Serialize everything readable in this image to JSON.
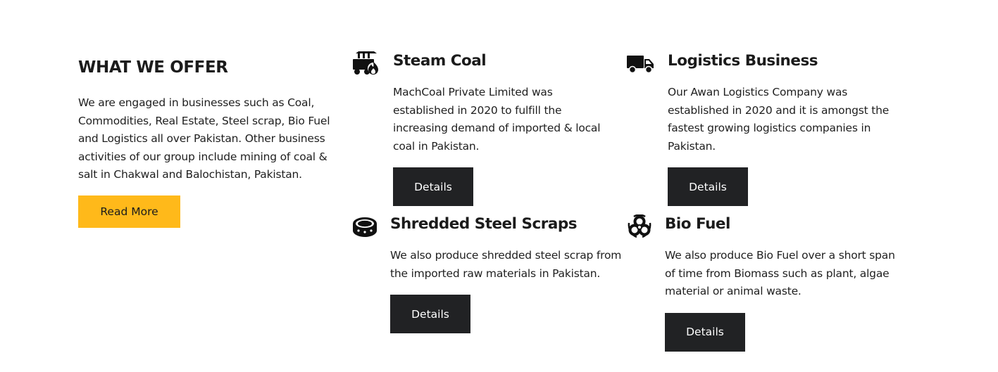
{
  "intro": {
    "title": "WHAT WE OFFER",
    "text": "We are engaged in businesses such as Coal, Commodities, Real Estate, Steel scrap, Bio Fuel and Logistics all over Pakistan. Other business activities of our group include mining of coal & salt in Chakwal and Balochistan, Pakistan.",
    "button_label": "Read More"
  },
  "services": [
    {
      "title": "Steam Coal",
      "icon": "coal-cart-icon",
      "text": "MachCoal Private Limited was established in 2020 to fulfill the increasing demand of imported & local coal in Pakistan.",
      "button_label": "Details"
    },
    {
      "title": "Logistics Business",
      "icon": "truck-icon",
      "text": "Our Awan Logistics Company was established in 2020 and it is amongst the fastest growing logistics companies in Pakistan.",
      "button_label": "Details"
    },
    {
      "title": "Shredded Steel Scraps",
      "icon": "steel-coil-icon",
      "text": "We also produce shredded steel scrap from the imported raw materials in Pakistan.",
      "button_label": "Details"
    },
    {
      "title": "Bio Fuel",
      "icon": "biohazard-icon",
      "text": "We also produce Bio Fuel over a short span of time from Biomass such as plant, algae material or animal waste.",
      "button_label": "Details"
    }
  ],
  "colors": {
    "accent": "#ffb91a",
    "button_dark": "#212224",
    "text": "#1b1b1b",
    "background": "#ffffff"
  }
}
